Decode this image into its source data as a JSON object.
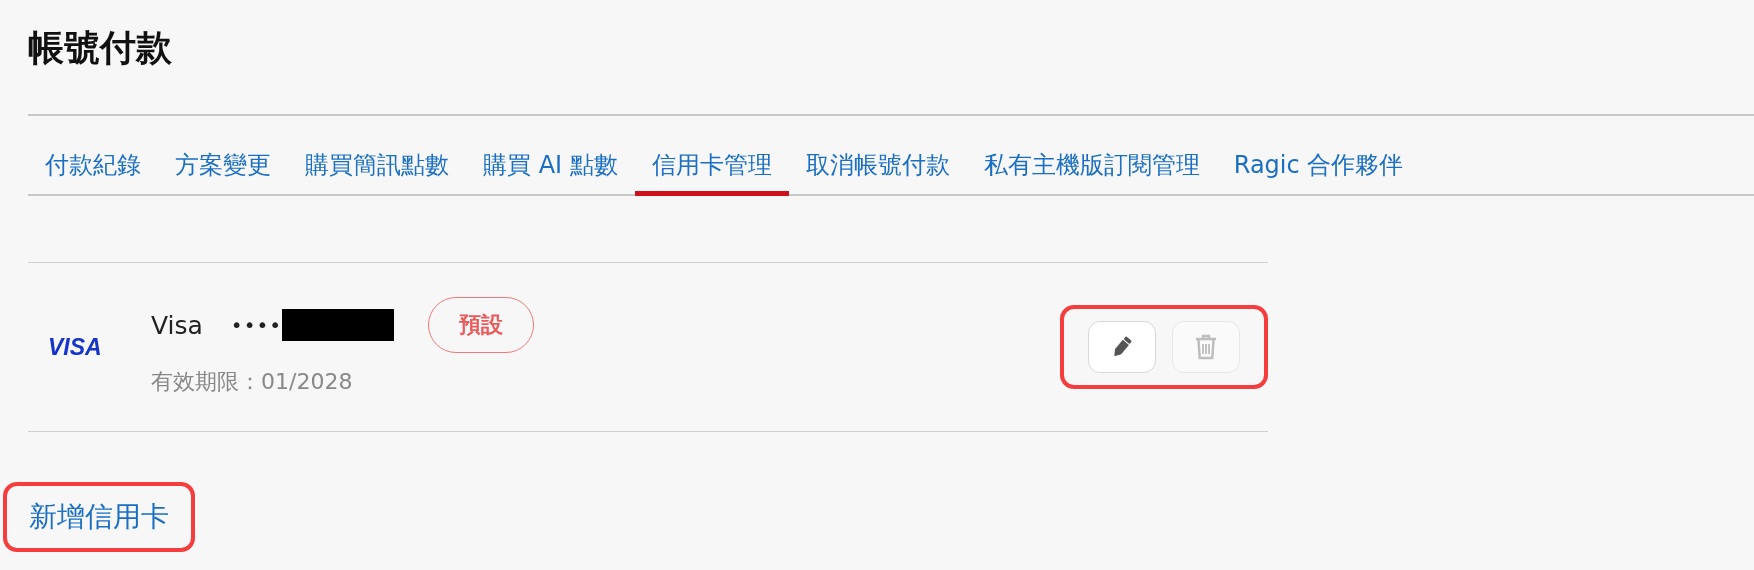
{
  "page": {
    "title": "帳號付款"
  },
  "tabs": [
    {
      "label": "付款紀錄",
      "selected": false
    },
    {
      "label": "方案變更",
      "selected": false
    },
    {
      "label": "購買簡訊點數",
      "selected": false
    },
    {
      "label": "購買 AI 點數",
      "selected": false
    },
    {
      "label": "信用卡管理",
      "selected": true
    },
    {
      "label": "取消帳號付款",
      "selected": false
    },
    {
      "label": "私有主機版訂閱管理",
      "selected": false
    },
    {
      "label": "Ragic 合作夥伴",
      "selected": false
    }
  ],
  "cards": [
    {
      "logo": "VISA",
      "brand": "Visa",
      "number": "••••",
      "number_redacted": true,
      "badge": "預設",
      "expiry": "有效期限：01/2028",
      "edit_disabled": false,
      "delete_disabled": true,
      "actions_highlighted": true
    }
  ],
  "add_card": {
    "label": "新增信用卡",
    "highlighted": true
  }
}
